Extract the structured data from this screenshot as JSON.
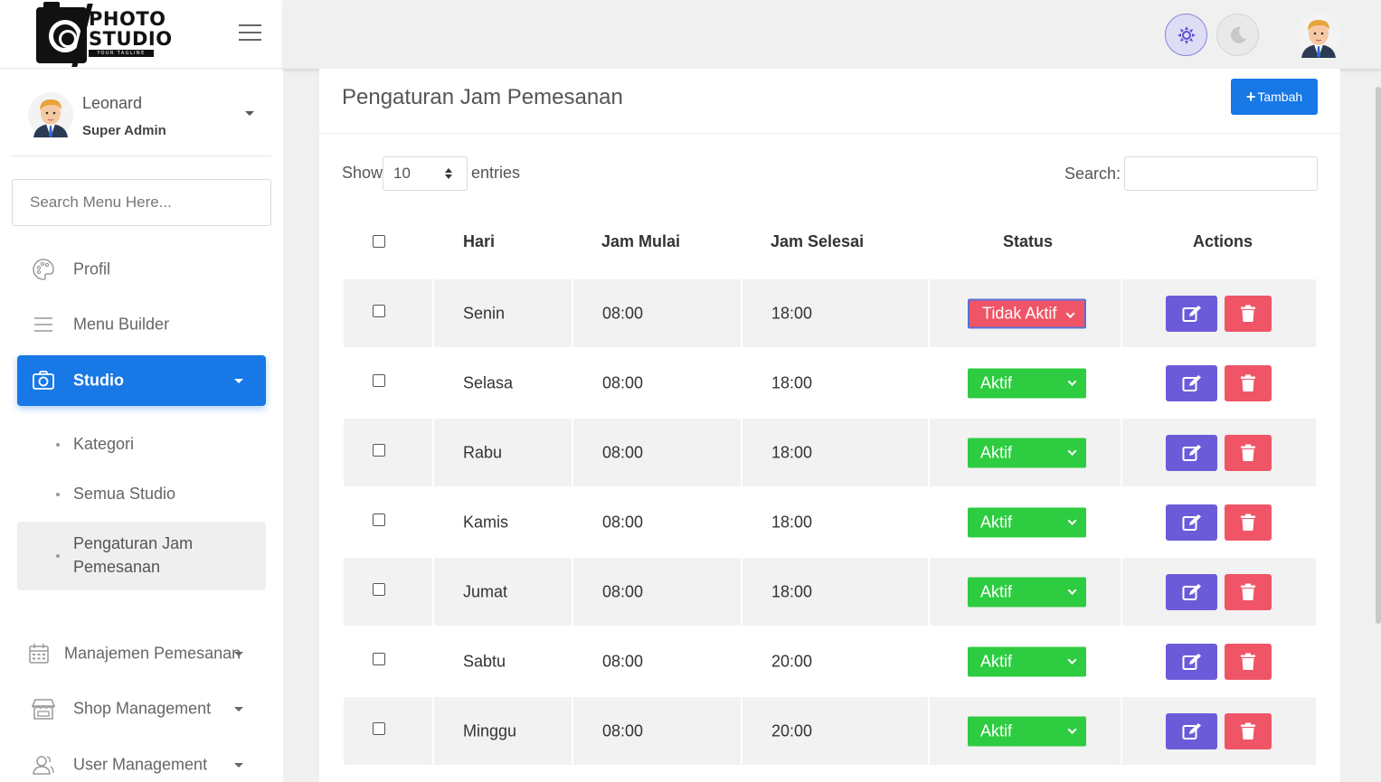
{
  "brand": {
    "line1": "PHOTO",
    "line2": "STUDIO",
    "tagline": "YOUR TAGLINE"
  },
  "user": {
    "name": "Leonard",
    "role": "Super Admin"
  },
  "sidebar": {
    "search_placeholder": "Search Menu Here...",
    "items": [
      {
        "label": "Profil",
        "icon": "palette-icon"
      },
      {
        "label": "Menu Builder",
        "icon": "menu-lines-icon"
      },
      {
        "label": "Studio",
        "icon": "camera-icon",
        "active": true
      },
      {
        "label": "Manajemen Pemesanan",
        "icon": "calendar-icon"
      },
      {
        "label": "Shop Management",
        "icon": "shop-icon"
      },
      {
        "label": "User Management",
        "icon": "users-icon"
      }
    ],
    "subitems": [
      {
        "label": "Kategori"
      },
      {
        "label": "Semua Studio"
      },
      {
        "label": "Pengaturan Jam Pemesanan",
        "active": true
      }
    ]
  },
  "page": {
    "title": "Pengaturan Jam Pemesanan",
    "add_button": "Tambah",
    "show_label": "Show",
    "entries_value": "10",
    "entries_label": "entries",
    "search_label": "Search:"
  },
  "table": {
    "columns": [
      "Hari",
      "Jam Mulai",
      "Jam Selesai",
      "Status",
      "Actions"
    ],
    "rows": [
      {
        "hari": "Senin",
        "mulai": "08:00",
        "selesai": "18:00",
        "status": "Tidak Aktif"
      },
      {
        "hari": "Selasa",
        "mulai": "08:00",
        "selesai": "18:00",
        "status": "Aktif"
      },
      {
        "hari": "Rabu",
        "mulai": "08:00",
        "selesai": "18:00",
        "status": "Aktif"
      },
      {
        "hari": "Kamis",
        "mulai": "08:00",
        "selesai": "18:00",
        "status": "Aktif"
      },
      {
        "hari": "Jumat",
        "mulai": "08:00",
        "selesai": "18:00",
        "status": "Aktif"
      },
      {
        "hari": "Sabtu",
        "mulai": "08:00",
        "selesai": "20:00",
        "status": "Aktif"
      },
      {
        "hari": "Minggu",
        "mulai": "08:00",
        "selesai": "20:00",
        "status": "Aktif"
      }
    ]
  },
  "colors": {
    "primary": "#1778e6",
    "active_status": "#2ecc40",
    "inactive_status": "#ef5566",
    "edit_button": "#6c5bd9",
    "delete_button": "#ef5566"
  }
}
